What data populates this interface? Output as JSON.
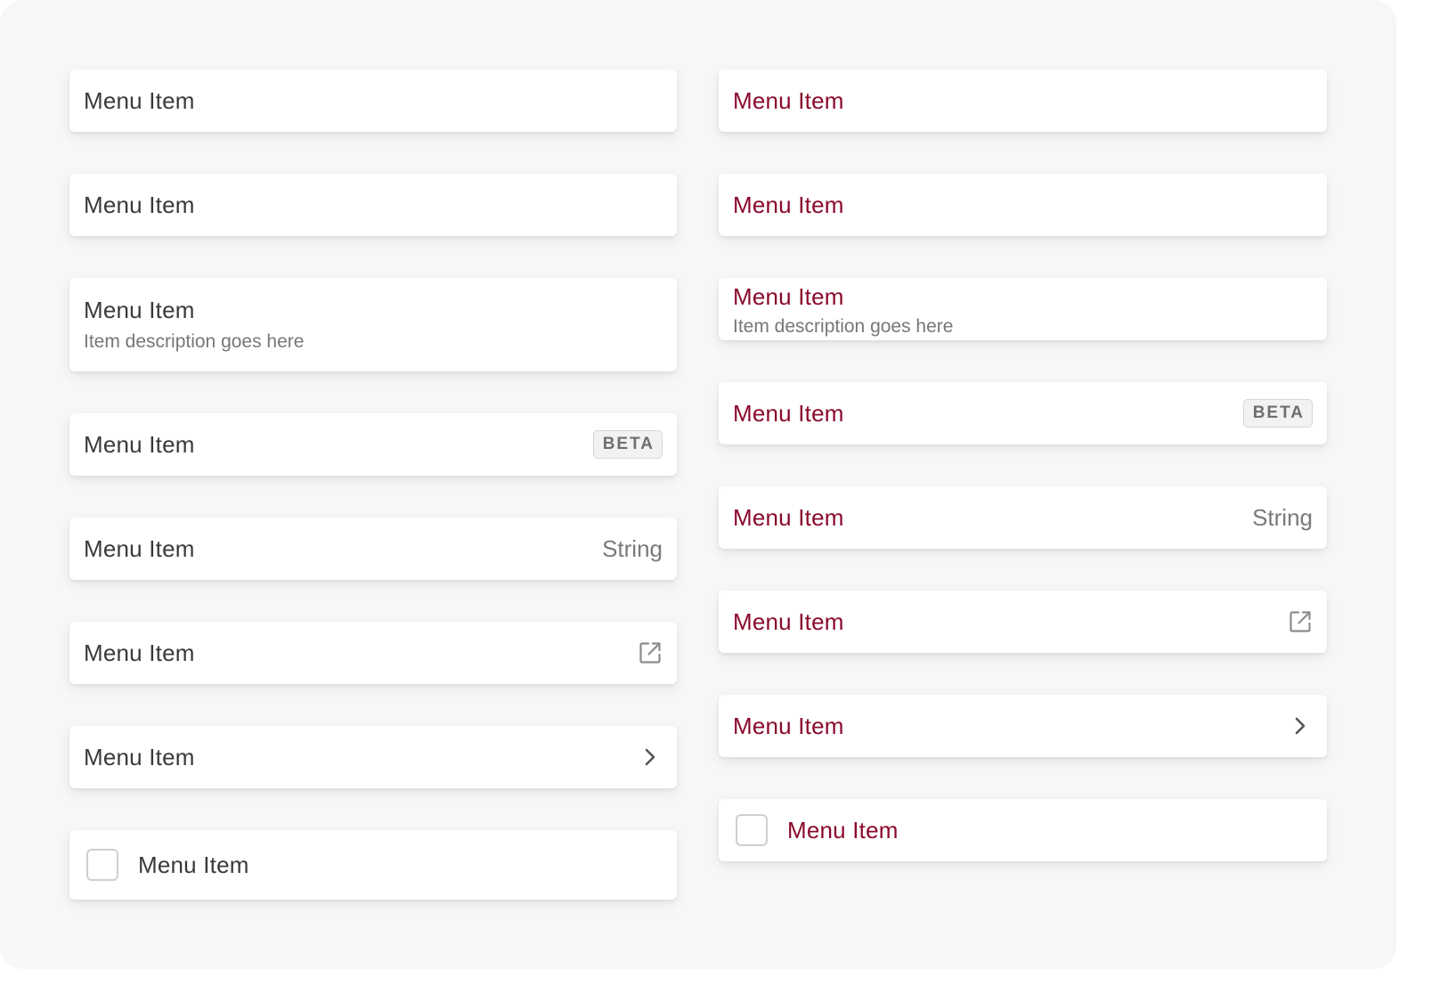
{
  "colors": {
    "page_background": "#f7f7f7",
    "default_text": "#3a3a3a",
    "accent_text": "#8a0a2c",
    "secondary_text": "#777777"
  },
  "left_column": {
    "plain_1": {
      "label": "Menu Item"
    },
    "plain_2": {
      "label": "Menu Item"
    },
    "with_description": {
      "label": "Menu Item",
      "description": "Item description goes here"
    },
    "with_badge": {
      "label": "Menu Item",
      "badge": "BETA"
    },
    "with_string": {
      "label": "Menu Item",
      "value": "String"
    },
    "with_external_link": {
      "label": "Menu Item",
      "icon": "external-link-icon"
    },
    "with_chevron": {
      "label": "Menu Item",
      "icon": "chevron-right-icon"
    },
    "with_checkbox": {
      "label": "Menu Item",
      "checked": false
    }
  },
  "right_column": {
    "plain_1": {
      "label": "Menu Item"
    },
    "plain_2": {
      "label": "Menu Item"
    },
    "with_description": {
      "label": "Menu Item",
      "description": "Item description goes here"
    },
    "with_badge": {
      "label": "Menu Item",
      "badge": "BETA"
    },
    "with_string": {
      "label": "Menu Item",
      "value": "String"
    },
    "with_external_link": {
      "label": "Menu Item",
      "icon": "external-link-icon"
    },
    "with_chevron": {
      "label": "Menu Item",
      "icon": "chevron-right-icon"
    },
    "with_checkbox": {
      "label": "Menu Item",
      "checked": false
    }
  }
}
